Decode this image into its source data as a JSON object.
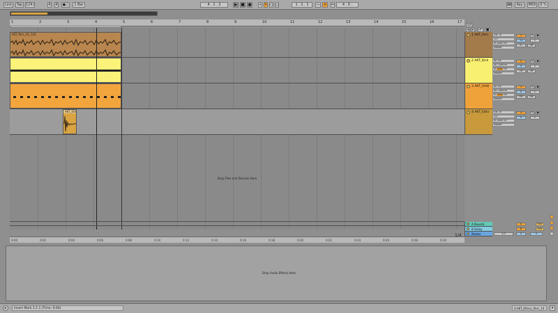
{
  "transport": {
    "link": "Link",
    "tap": "Tap",
    "tempo": "124.00",
    "sig_num": "4",
    "sig_den": "4",
    "metro": "●○",
    "quantize": "1 Bar",
    "arr_position": "4 .   1 .   2",
    "punch_in": "1 .   1 .   1",
    "loop_length": "4 .   0 .",
    "key": "Key",
    "midi": "MIDI",
    "cpu": "0 %"
  },
  "ruler": {
    "bars": [
      "1",
      "2",
      "3",
      "4",
      "5",
      "6",
      "7",
      "8",
      "9",
      "10",
      "11",
      "12",
      "13",
      "14",
      "15",
      "16",
      "17"
    ]
  },
  "timeline": {
    "labels": [
      "0:00",
      "0:02",
      "0:04",
      "0:06",
      "0:08",
      "0:10",
      "0:12",
      "0:14",
      "0:16",
      "0:18",
      "0:20",
      "0:22",
      "0:24",
      "0:26",
      "0:28",
      "0:30"
    ],
    "zoom": "1/4"
  },
  "tracks": [
    {
      "name": "1 AKT_Perc",
      "color": "#a37a4a",
      "clip_name": "AKT_Perc_01_124",
      "input": "Ext. In",
      "channel": "",
      "sub": "1/2",
      "num": "1",
      "vol": "-14",
      "monitor": [
        "In",
        "Auto",
        "Off"
      ],
      "out": "Master",
      "clip_color": "#b8864e"
    },
    {
      "name": "2 AKT_Kick",
      "color": "#f8f070",
      "clip_name": "",
      "input": "All Ins",
      "channel": "All Channe",
      "sub": "",
      "num": "2",
      "vol": "0",
      "monitor": [
        "In",
        "Auto",
        "Off"
      ],
      "out": "Master",
      "clip_color": "#fbf27a"
    },
    {
      "name": "3 AKT_HHO",
      "color": "#f0a23a",
      "clip_name": "",
      "input": "All Ins",
      "channel": "All Channe",
      "sub": "",
      "num": "3",
      "vol": "0",
      "monitor": [
        "In",
        "Auto",
        "Off"
      ],
      "out": "Master",
      "clip_color": "#f3a53d"
    },
    {
      "name": "4 AKT_Ethn",
      "color": "#c89a3c",
      "clip_name": "AKT_Ethn",
      "input": "Ext. In",
      "channel": "",
      "sub": "1/2",
      "num": "4",
      "vol": "0",
      "monitor": [
        "In",
        "Auto",
        "Off"
      ],
      "out": "Master",
      "clip_color": "#d9a441"
    }
  ],
  "returns": [
    {
      "name": "A Reverb",
      "color": "#63c9b6",
      "letter": "A"
    },
    {
      "name": "B Delay",
      "color": "#84cce0",
      "letter": "B"
    },
    {
      "name": "Master",
      "color": "#6aa5e0",
      "letter": "",
      "out": "1/2"
    }
  ],
  "arrangement": {
    "drop_hint": "Drop Files and Devices Here",
    "set_label": "Set"
  },
  "detail": {
    "drop_hint": "Drop Audio Effects Here"
  },
  "status": {
    "message": "Insert Mark 1.1.1 (Time: 0:00)",
    "selection": "4-AKT_Ethnic_Perc_10"
  },
  "monitor_off_label": "Off",
  "monitor_in_label": "In",
  "monitor_auto_label": "Auto",
  "solo": "S",
  "cue": "C",
  "post": "Post"
}
